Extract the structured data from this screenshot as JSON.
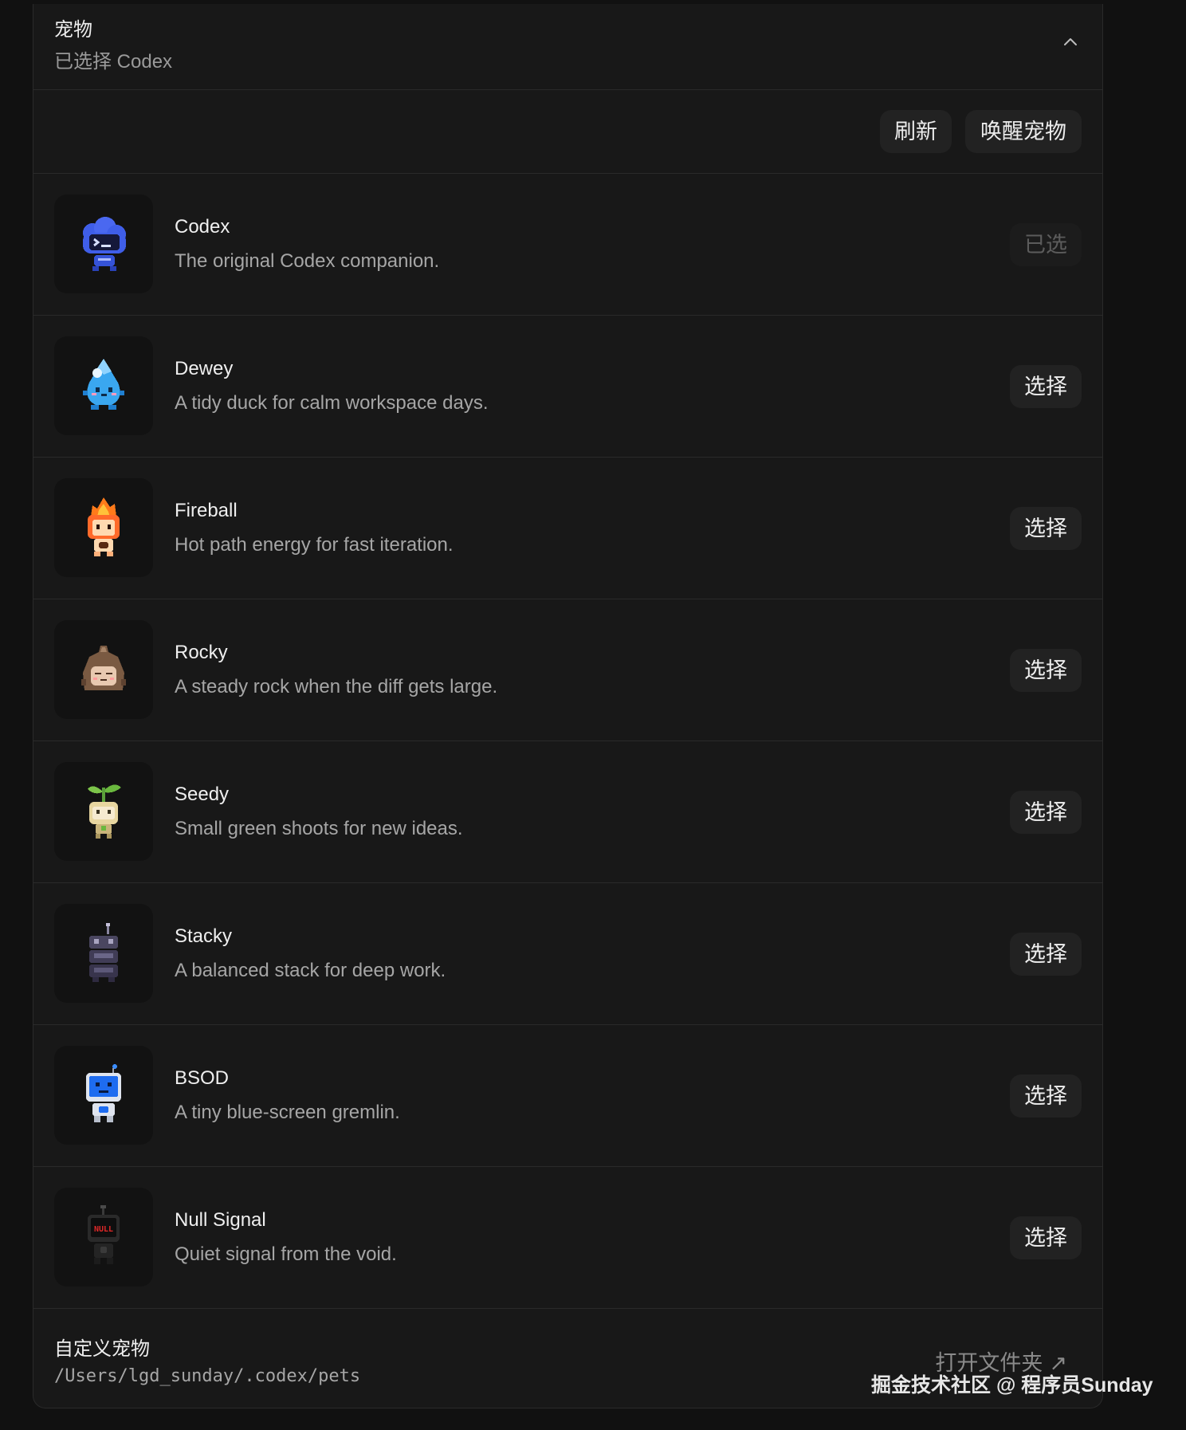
{
  "header": {
    "title": "宠物",
    "subtitle": "已选择 Codex"
  },
  "toolbar": {
    "refresh_label": "刷新",
    "wake_label": "唤醒宠物"
  },
  "pets": [
    {
      "name": "Codex",
      "description": "The original Codex companion.",
      "action": "已选",
      "selected": true,
      "icon": "codex-cloud-terminal-icon"
    },
    {
      "name": "Dewey",
      "description": "A tidy duck for calm workspace days.",
      "action": "选择",
      "selected": false,
      "icon": "dewey-droplet-icon"
    },
    {
      "name": "Fireball",
      "description": "Hot path energy for fast iteration.",
      "action": "选择",
      "selected": false,
      "icon": "fireball-flame-icon"
    },
    {
      "name": "Rocky",
      "description": "A steady rock when the diff gets large.",
      "action": "选择",
      "selected": false,
      "icon": "rocky-rock-icon"
    },
    {
      "name": "Seedy",
      "description": "Small green shoots for new ideas.",
      "action": "选择",
      "selected": false,
      "icon": "seedy-sprout-icon"
    },
    {
      "name": "Stacky",
      "description": "A balanced stack for deep work.",
      "action": "选择",
      "selected": false,
      "icon": "stacky-stack-icon"
    },
    {
      "name": "BSOD",
      "description": "A tiny blue-screen gremlin.",
      "action": "选择",
      "selected": false,
      "icon": "bsod-monitor-icon"
    },
    {
      "name": "Null Signal",
      "description": "Quiet signal from the void.",
      "action": "选择",
      "selected": false,
      "icon": "null-signal-icon",
      "icon_text": "NULL"
    }
  ],
  "custom": {
    "title": "自定义宠物",
    "path": "/Users/lgd_sunday/.codex/pets",
    "open_folder_label": "打开文件夹",
    "open_folder_arrow": "↗"
  },
  "watermark": "掘金技术社区 @ 程序员Sunday",
  "colors": {
    "page_bg": "#111111",
    "panel_bg": "#181818",
    "divider": "#2a2a2a",
    "button_bg": "#222222",
    "primary_text": "#efefef",
    "secondary_text": "#a6a6a6"
  }
}
